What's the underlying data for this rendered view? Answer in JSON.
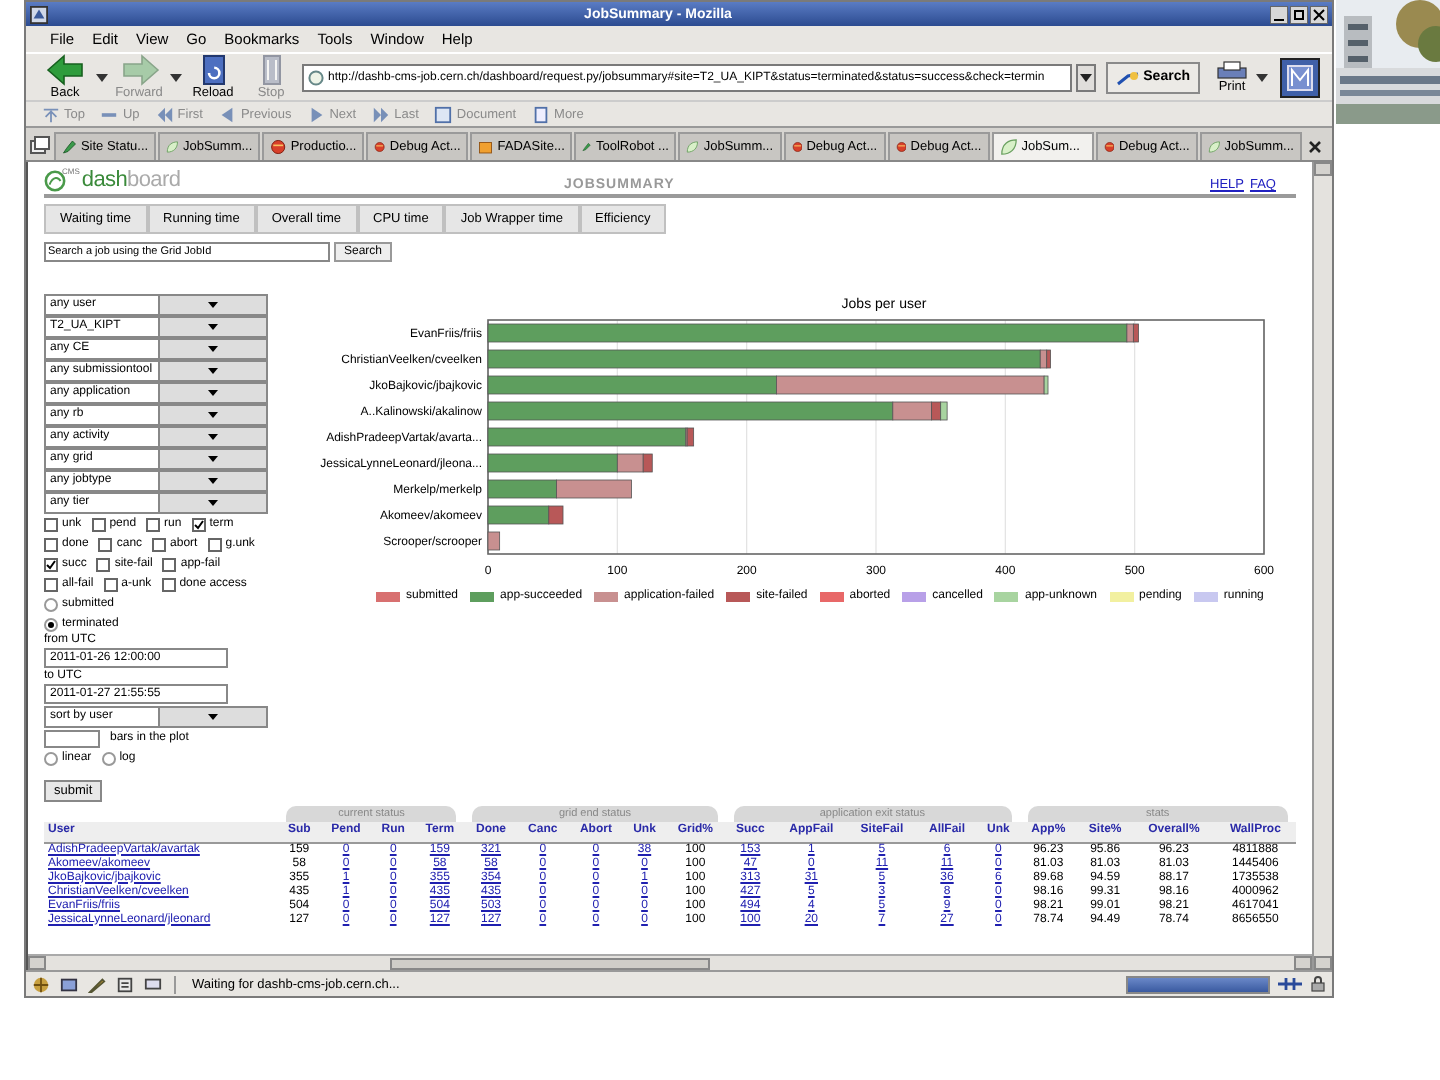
{
  "window": {
    "title": "JobSummary - Mozilla"
  },
  "menu": [
    "File",
    "Edit",
    "View",
    "Go",
    "Bookmarks",
    "Tools",
    "Window",
    "Help"
  ],
  "nav_buttons": [
    {
      "label": "Back",
      "kind": "back",
      "disabled": false
    },
    {
      "label": "Forward",
      "kind": "forward",
      "disabled": true
    },
    {
      "label": "Reload",
      "kind": "reload",
      "disabled": false
    },
    {
      "label": "Stop",
      "kind": "stop",
      "disabled": true
    }
  ],
  "address": {
    "value": "http://dashb-cms-job.cern.ch/dashboard/request.py/jobsummary#site=T2_UA_KIPT&status=terminated&status=success&check=termin"
  },
  "search_button": "Search",
  "print_button": "Print",
  "personal_toolbar": [
    {
      "label": "Top",
      "kind": "top",
      "disabled": true
    },
    {
      "label": "Up",
      "kind": "up",
      "disabled": true
    },
    {
      "label": "First",
      "kind": "first",
      "disabled": true
    },
    {
      "label": "Previous",
      "kind": "previous",
      "disabled": true
    },
    {
      "label": "Next",
      "kind": "next",
      "disabled": true
    },
    {
      "label": "Last",
      "kind": "last",
      "disabled": true
    },
    {
      "label": "Document",
      "kind": "document",
      "disabled": true
    },
    {
      "label": "More",
      "kind": "more",
      "disabled": true
    }
  ],
  "tabs": [
    {
      "label": "Site Statu...",
      "kind": "tool",
      "selected": false
    },
    {
      "label": "JobSumm...",
      "kind": "dash",
      "selected": false
    },
    {
      "label": "Productio...",
      "kind": "debug",
      "selected": false
    },
    {
      "label": "Debug Act...",
      "kind": "debug",
      "selected": false
    },
    {
      "label": "FADASite...",
      "kind": "folder",
      "selected": false
    },
    {
      "label": "ToolRobot ...",
      "kind": "tool",
      "selected": false
    },
    {
      "label": "JobSumm...",
      "kind": "dash",
      "selected": false
    },
    {
      "label": "Debug Act...",
      "kind": "debug",
      "selected": false
    },
    {
      "label": "Debug Act...",
      "kind": "debug",
      "selected": false
    },
    {
      "label": "JobSum...",
      "kind": "dash",
      "selected": true
    },
    {
      "label": "Debug Act...",
      "kind": "debug",
      "selected": false
    },
    {
      "label": "JobSumm...",
      "kind": "dash",
      "selected": false
    }
  ],
  "dashboard": {
    "logo": {
      "sup": "CMS",
      "parts": [
        "dash",
        "board"
      ]
    },
    "title": "JOBSUMMARY",
    "links": [
      "HELP",
      "FAQ"
    ],
    "tabs": [
      {
        "label": "Waiting time",
        "selected": false
      },
      {
        "label": "Running time",
        "selected": false
      },
      {
        "label": "Overall time",
        "selected": false
      },
      {
        "label": "CPU time",
        "selected": false
      },
      {
        "label": "Job Wrapper time",
        "selected": false
      },
      {
        "label": "Efficiency",
        "selected": false
      }
    ],
    "search": {
      "placeholder": "Search a job using the Grid JobId",
      "button": "Search"
    }
  },
  "filters": [
    {
      "kind": "select",
      "value": "any user"
    },
    {
      "kind": "select",
      "value": "T2_UA_KIPT"
    },
    {
      "kind": "select",
      "value": "any CE"
    },
    {
      "kind": "select",
      "value": "any submissiontool"
    },
    {
      "kind": "select",
      "value": "any application"
    },
    {
      "kind": "select",
      "value": "any rb"
    },
    {
      "kind": "select",
      "value": "any activity"
    },
    {
      "kind": "select",
      "value": "any grid"
    },
    {
      "kind": "select",
      "value": "any jobtype"
    },
    {
      "kind": "select",
      "value": "any tier"
    },
    {
      "kind": "checks",
      "options": [
        {
          "label": "unk",
          "checked": false
        },
        {
          "label": "pend",
          "checked": false
        },
        {
          "label": "run",
          "checked": false
        },
        {
          "label": "term",
          "checked": true
        }
      ]
    },
    {
      "kind": "checks",
      "options": [
        {
          "label": "done",
          "checked": false
        },
        {
          "label": "canc",
          "checked": false
        },
        {
          "label": "abort",
          "checked": false
        },
        {
          "label": "g.unk",
          "checked": false
        }
      ]
    },
    {
      "kind": "checks",
      "options": [
        {
          "label": "succ",
          "checked": true
        },
        {
          "label": "site-fail",
          "checked": false
        },
        {
          "label": "app-fail",
          "checked": false
        }
      ]
    },
    {
      "kind": "checks",
      "options": [
        {
          "label": "all-fail",
          "checked": false
        },
        {
          "label": "a-unk",
          "checked": false
        },
        {
          "label": "done access",
          "checked": false
        }
      ]
    },
    {
      "kind": "radio",
      "label": "submitted",
      "selected": false
    },
    {
      "kind": "radio",
      "label": "terminated",
      "selected": true
    },
    {
      "kind": "label",
      "text": "from UTC"
    },
    {
      "kind": "field",
      "value": "2011-01-26 12:00:00"
    },
    {
      "kind": "label",
      "text": "to UTC"
    },
    {
      "kind": "field",
      "value": "2011-01-27 21:55:55"
    },
    {
      "kind": "select",
      "value": "sort by user"
    },
    {
      "kind": "bars",
      "label": "bars in the plot"
    },
    {
      "kind": "radios",
      "options": [
        {
          "label": "linear",
          "selected": false
        },
        {
          "label": "log",
          "selected": false
        }
      ]
    },
    {
      "kind": "button",
      "label": "submit"
    }
  ],
  "chart_data": {
    "type": "bar",
    "orientation": "horizontal",
    "stacked": true,
    "title": "Jobs per user",
    "categories": [
      "EvanFriis/friis",
      "ChristianVeelken/cveelken",
      "JkoBajkovic/jbajkovic",
      "A..Kalinowski/akalinow",
      "AdishPradeepVartak/avarta...",
      "JessicaLynneLeonard/jleona...",
      "Merkelp/merkelp",
      "Akomeev/akomeev",
      "Scrooper/scrooper"
    ],
    "xlim": [
      0,
      600
    ],
    "grid": true,
    "xticks": [
      0,
      100,
      200,
      300,
      400,
      500,
      600
    ],
    "series": [
      {
        "name": "submitted",
        "color": "#d87070",
        "values": [
          0,
          0,
          0,
          0,
          0,
          0,
          0,
          0,
          0
        ]
      },
      {
        "name": "app-succeeded",
        "color": "#5e9e5e",
        "values": [
          494,
          427,
          223,
          313,
          153,
          100,
          53,
          47,
          0
        ]
      },
      {
        "name": "application-failed",
        "color": "#c89090",
        "values": [
          5,
          5,
          207,
          30,
          1,
          20,
          58,
          0,
          9
        ]
      },
      {
        "name": "site-failed",
        "color": "#b85858",
        "values": [
          4,
          3,
          0,
          7,
          5,
          7,
          0,
          11,
          0
        ]
      },
      {
        "name": "aborted",
        "color": "#e86868",
        "values": [
          0,
          0,
          0,
          0,
          0,
          0,
          0,
          0,
          0
        ]
      },
      {
        "name": "cancelled",
        "color": "#b8a0e8",
        "values": [
          0,
          0,
          0,
          0,
          0,
          0,
          0,
          0,
          0
        ]
      },
      {
        "name": "app-unknown",
        "color": "#a8d4a0",
        "values": [
          0,
          0,
          3,
          5,
          0,
          0,
          0,
          0,
          0
        ]
      },
      {
        "name": "pending",
        "color": "#f2f0a0",
        "values": [
          0,
          0,
          0,
          0,
          0,
          0,
          0,
          0,
          0
        ]
      },
      {
        "name": "running",
        "color": "#c8c8f0",
        "values": [
          0,
          0,
          0,
          0,
          0,
          0,
          0,
          0,
          0
        ]
      }
    ]
  },
  "table": {
    "groups": [
      {
        "columns": [
          {
            "label": "User",
            "link": true
          }
        ]
      },
      {
        "label": "current status",
        "columns": [
          {
            "label": "Sub",
            "link": false
          },
          {
            "label": "Pend",
            "link": true
          },
          {
            "label": "Run",
            "link": true
          },
          {
            "label": "Term",
            "link": true
          }
        ]
      },
      {
        "label": "grid end status",
        "columns": [
          {
            "label": "Done",
            "link": true
          },
          {
            "label": "Canc",
            "link": true
          },
          {
            "label": "Abort",
            "link": true
          },
          {
            "label": "Unk",
            "link": true
          },
          {
            "label": "Grid%",
            "link": false
          }
        ]
      },
      {
        "label": "application exit status",
        "columns": [
          {
            "label": "Succ",
            "link": true
          },
          {
            "label": "AppFail",
            "link": true
          },
          {
            "label": "SiteFail",
            "link": true
          },
          {
            "label": "AllFail",
            "link": true
          },
          {
            "label": "Unk",
            "link": true
          }
        ]
      },
      {
        "label": "stats",
        "columns": [
          {
            "label": "App%",
            "link": false
          },
          {
            "label": "Site%",
            "link": false
          },
          {
            "label": "Overall%",
            "link": false
          },
          {
            "label": "WallProc",
            "link": false
          }
        ]
      }
    ],
    "rows": [
      [
        "AdishPradeepVartak/avartak",
        "159",
        "0",
        "0",
        "159",
        "321",
        "0",
        "0",
        "38",
        "100",
        "153",
        "1",
        "5",
        "6",
        "0",
        "96.23",
        "95.86",
        "96.23",
        "4811888"
      ],
      [
        "Akomeev/akomeev",
        "58",
        "0",
        "0",
        "58",
        "58",
        "0",
        "0",
        "0",
        "100",
        "47",
        "0",
        "11",
        "11",
        "0",
        "81.03",
        "81.03",
        "81.03",
        "1445406"
      ],
      [
        "JkoBajkovic/jbajkovic",
        "355",
        "1",
        "0",
        "355",
        "354",
        "0",
        "0",
        "1",
        "100",
        "313",
        "31",
        "5",
        "36",
        "6",
        "89.68",
        "94.59",
        "88.17",
        "1735538"
      ],
      [
        "ChristianVeelken/cveelken",
        "435",
        "1",
        "0",
        "435",
        "435",
        "0",
        "0",
        "0",
        "100",
        "427",
        "5",
        "3",
        "8",
        "0",
        "98.16",
        "99.31",
        "98.16",
        "4000962"
      ],
      [
        "EvanFriis/friis",
        "504",
        "0",
        "0",
        "504",
        "503",
        "0",
        "0",
        "0",
        "100",
        "494",
        "4",
        "5",
        "9",
        "0",
        "98.21",
        "99.01",
        "98.21",
        "4617041"
      ],
      [
        "JessicaLynneLeonard/jleonard",
        "127",
        "0",
        "0",
        "127",
        "127",
        "0",
        "0",
        "0",
        "100",
        "100",
        "20",
        "7",
        "27",
        "0",
        "78.74",
        "94.49",
        "78.74",
        "8656550"
      ]
    ]
  },
  "status_bar": {
    "text": "Waiting for dashb-cms-job.cern.ch...",
    "progress": {
      "level": 1
    }
  }
}
